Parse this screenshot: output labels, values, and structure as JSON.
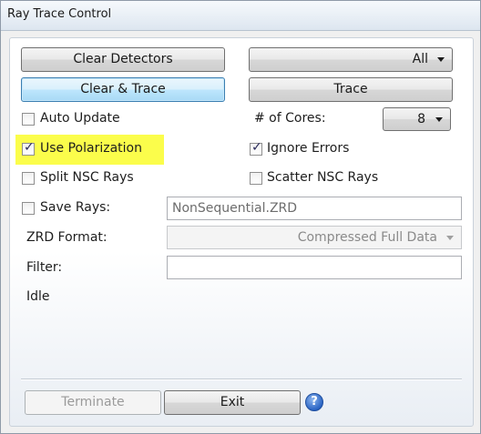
{
  "window": {
    "title": "Ray Trace Control"
  },
  "buttons": {
    "clear_detectors": "Clear Detectors",
    "clear_and_trace": "Clear & Trace",
    "trace": "Trace",
    "terminate": "Terminate",
    "exit": "Exit"
  },
  "detector_select": {
    "value": "All"
  },
  "options": {
    "auto_update": {
      "label": "Auto Update",
      "checked": false
    },
    "use_polarization": {
      "label": "Use Polarization",
      "checked": true
    },
    "ignore_errors": {
      "label": "Ignore Errors",
      "checked": true
    },
    "split_nsc_rays": {
      "label": "Split NSC Rays",
      "checked": false
    },
    "scatter_nsc_rays": {
      "label": "Scatter NSC Rays",
      "checked": false
    },
    "save_rays": {
      "label": "Save Rays:",
      "checked": false
    }
  },
  "cores": {
    "label": "# of Cores:",
    "value": "8"
  },
  "save_rays_file": {
    "value": "NonSequential.ZRD"
  },
  "zrd_format": {
    "label": "ZRD Format:",
    "value": "Compressed Full Data"
  },
  "filter": {
    "label": "Filter:",
    "value": ""
  },
  "status": {
    "text": "Idle"
  },
  "colors": {
    "highlight": "#fbfd4b",
    "focus_border": "#3c7fb1"
  },
  "icons": {
    "help": "help-icon",
    "check": "check-icon",
    "dropdown": "chevron-down-icon"
  },
  "help_glyph": "?",
  "check_glyph": "✓"
}
